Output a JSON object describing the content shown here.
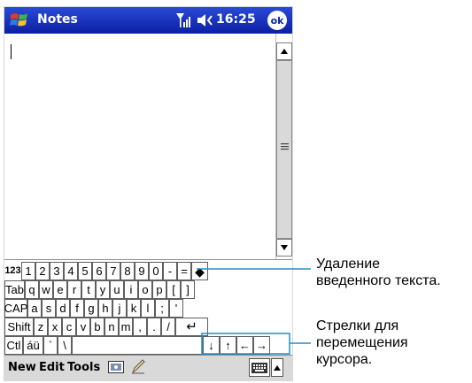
{
  "title_bar": {
    "app_title": "Notes",
    "time": "16:25",
    "ok_label": "ok",
    "icons": [
      "windows-start-icon",
      "signal-icon",
      "volume-icon"
    ],
    "colors": {
      "bar": "#1730bd",
      "text": "#ffffff"
    }
  },
  "note": {
    "content": ""
  },
  "keyboard": {
    "rows": [
      [
        "123",
        "1",
        "2",
        "3",
        "4",
        "5",
        "6",
        "7",
        "8",
        "9",
        "0",
        "-",
        "=",
        "◆"
      ],
      [
        "Tab",
        "q",
        "w",
        "e",
        "r",
        "t",
        "y",
        "u",
        "i",
        "o",
        "p",
        "[",
        "]"
      ],
      [
        "CAP",
        "a",
        "s",
        "d",
        "f",
        "g",
        "h",
        "j",
        "k",
        "l",
        ";",
        "'"
      ],
      [
        "Shift",
        "z",
        "x",
        "c",
        "v",
        "b",
        "n",
        "m",
        ",",
        ".",
        "/",
        "↵"
      ],
      [
        "Ctl",
        "áü",
        "`",
        "\\",
        "↓",
        "↑",
        "←",
        "→"
      ]
    ]
  },
  "menu_bar": {
    "new_label": "New",
    "edit_label": "Edit",
    "tools_label": "Tools",
    "icons": [
      "recording-icon",
      "pen-icon",
      "keyboard-icon",
      "input-menu-arrow-icon"
    ]
  },
  "callouts": {
    "delete_text": [
      "Удаление",
      "введенного текста."
    ],
    "arrow_keys": [
      "Стрелки для",
      "перемещения",
      "курсора."
    ],
    "highlight_color": "#1f8fc7"
  }
}
